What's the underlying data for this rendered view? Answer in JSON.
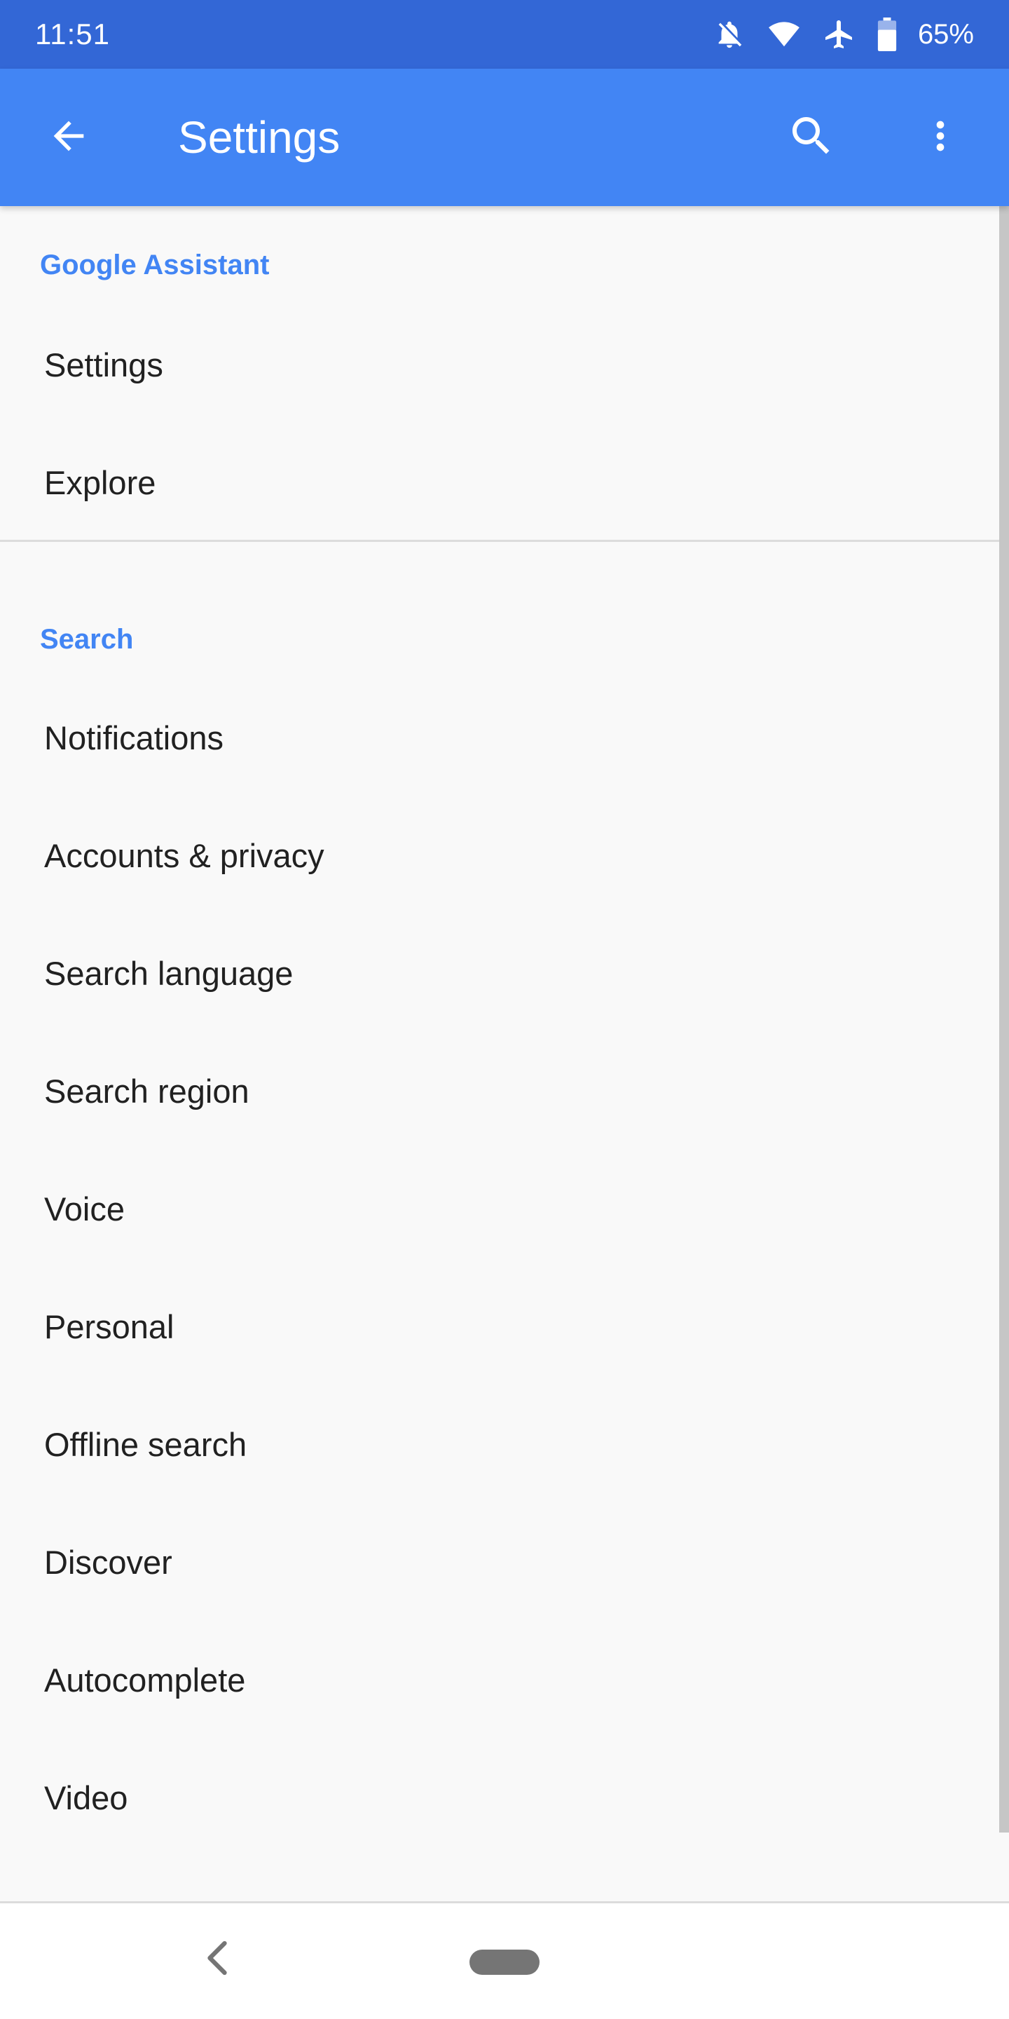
{
  "status_bar": {
    "time": "11:51",
    "battery": "65%",
    "icons": [
      "notifications-off-icon",
      "wifi-icon",
      "airplane-icon",
      "battery-icon"
    ]
  },
  "app_bar": {
    "title": "Settings",
    "back_icon": "arrow-back-icon",
    "search_icon": "search-icon",
    "more_icon": "more-vert-icon"
  },
  "sections": [
    {
      "header": "Google Assistant",
      "items": [
        "Settings",
        "Explore"
      ]
    },
    {
      "header": "Search",
      "items": [
        "Notifications",
        "Accounts & privacy",
        "Search language",
        "Search region",
        "Voice",
        "Personal",
        "Offline search",
        "Discover",
        "Autocomplete",
        "Video"
      ]
    }
  ],
  "nav_bar": {
    "back_icon": "nav-back-icon",
    "home_icon": "nav-home-pill"
  },
  "colors": {
    "status_bar": "#3367d6",
    "app_bar": "#4285f4",
    "section_header": "#4285f4",
    "background": "#f9f9f9"
  }
}
